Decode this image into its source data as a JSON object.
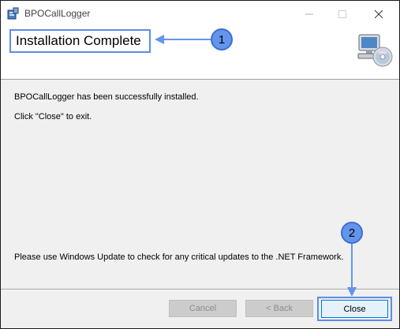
{
  "window": {
    "title": "BPOCallLogger",
    "controls": {
      "minimize": "minimize",
      "maximize": "maximize",
      "close": "close"
    }
  },
  "header": {
    "heading": "Installation Complete"
  },
  "body": {
    "line1": "BPOCallLogger has been successfully installed.",
    "line2": "Click \"Close\" to exit.",
    "line3": "Please use Windows Update to check for any critical updates to the .NET Framework."
  },
  "buttons": {
    "cancel": "Cancel",
    "back": "< Back",
    "close": "Close"
  },
  "annotations": {
    "callout1": "1",
    "callout2": "2",
    "accent": "#5b8ee6"
  },
  "icons": {
    "app": "installer-icon",
    "header": "computer-cd-icon"
  }
}
